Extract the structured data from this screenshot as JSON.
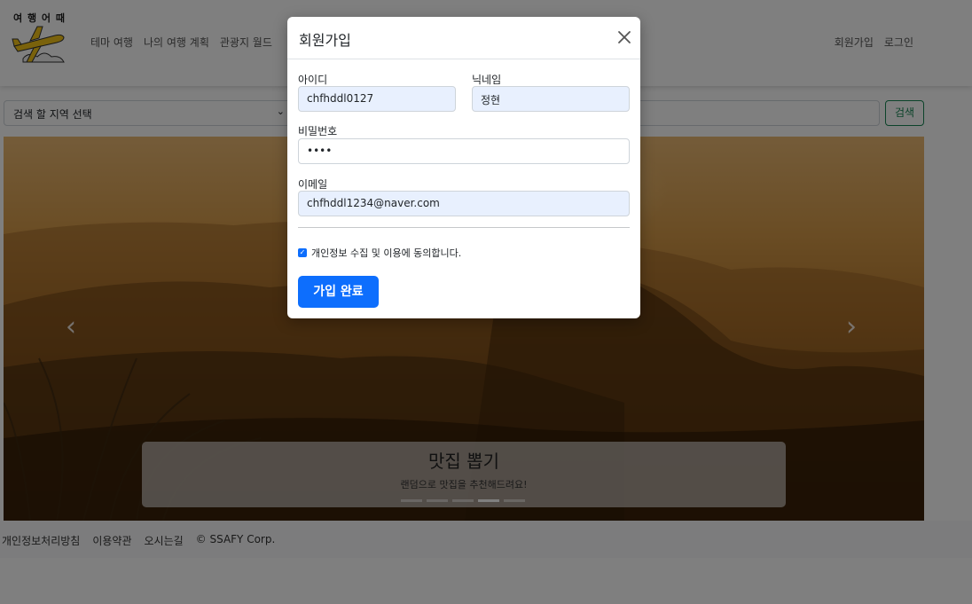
{
  "brand": {
    "logo_text": "여 행 어 때"
  },
  "nav": {
    "menu": [
      "테마 여행",
      "나의 여행 계획",
      "관광지 월드"
    ],
    "signup_label": "회원가입",
    "login_label": "로그인"
  },
  "search": {
    "region_select_value": "검색 할 지역 선택",
    "button_label": "검색"
  },
  "carousel": {
    "title": "맛집 뽑기",
    "description": "랜덤으로 맛집을 추천해드려요!",
    "indicator_count": 5,
    "active_indicator": 4,
    "prev_icon": "‹",
    "next_icon": "›"
  },
  "footer": {
    "links": [
      "개인정보처리방침",
      "이용약관",
      "오시는길",
      "© SSAFY Corp."
    ]
  },
  "modal": {
    "title": "회원가입",
    "id_label": "아이디",
    "id_value": "chfhddl0127",
    "nickname_label": "닉네임",
    "nickname_value": "정현",
    "password_label": "비밀번호",
    "password_value": "••••",
    "email_label": "이메일",
    "email_value": "chfhddl1234@naver.com",
    "agree_label": "개인정보 수집 및 이용에 동의합니다.",
    "agree_checked": true,
    "submit_label": "가입 완료"
  },
  "colors": {
    "primary": "#0d6efd",
    "search_button": "#198754",
    "autofill_background": "#e8f0fe"
  }
}
